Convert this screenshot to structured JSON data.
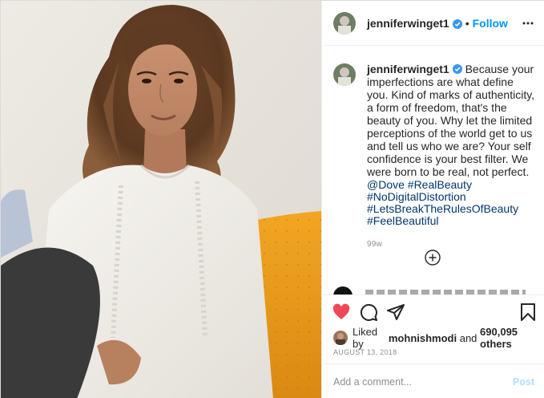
{
  "header": {
    "username": "jenniferwinget1",
    "separator": "•",
    "follow_label": "Follow"
  },
  "caption": {
    "username": "jenniferwinget1",
    "text": "Because your imperfections are what define you. Kind of marks of authenticity, a form of freedom, that's the beauty of you. Why let the limited perceptions of the world get to us and tell us who we are? Your self confidence is your best filter. We were born to be real, not perfect.",
    "hashtags": [
      "@Dove #RealBeauty",
      "#NoDigitalDistortion",
      "#LetsBreakTheRulesOfBeauty",
      "#FeelBeautiful"
    ],
    "time_ago": "99w"
  },
  "likes": {
    "prefix": "Liked by",
    "user": "mohnishmodi",
    "middle": "and",
    "count": "690,095 others"
  },
  "date": "AUGUST 13, 2018",
  "comment": {
    "placeholder": "Add a comment...",
    "post_label": "Post"
  },
  "icons": {
    "verified": "verified-badge-icon",
    "more": "more-options-icon",
    "load_more": "plus-circle-icon",
    "like": "heart-icon",
    "comment": "comment-icon",
    "share": "paper-plane-icon",
    "save": "bookmark-icon"
  },
  "colors": {
    "link": "#00376b",
    "follow": "#0095f6",
    "heart": "#ed4956",
    "verified": "#3897f0",
    "post_disabled": "#b2dffc"
  }
}
